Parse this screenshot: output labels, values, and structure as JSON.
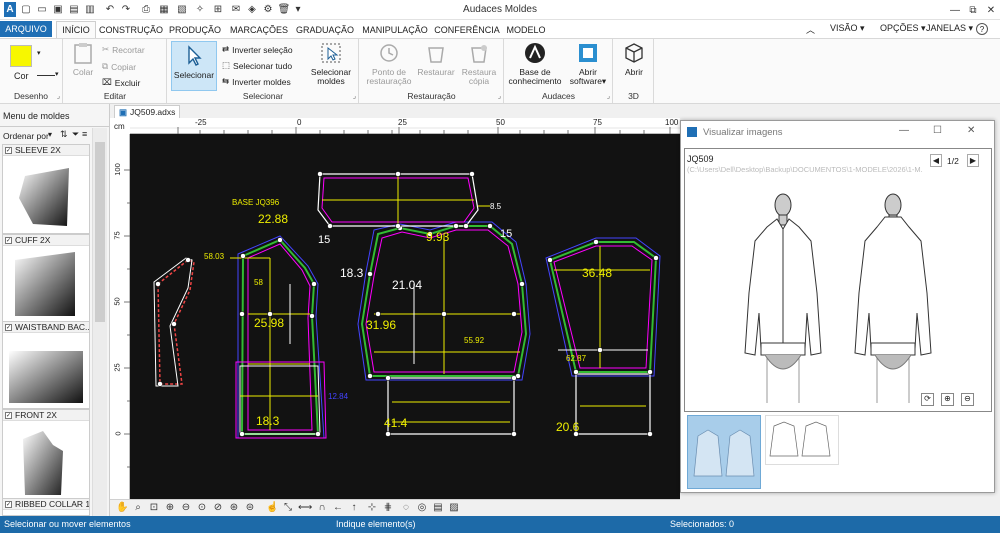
{
  "app": {
    "title": "Audaces Moldes"
  },
  "window_controls": {
    "min": "—",
    "max": "⧉",
    "close": "✕"
  },
  "tabs": [
    "ARQUIVO",
    "INÍCIO",
    "CONSTRUÇÃO",
    "PRODUÇÃO",
    "MARCAÇÕES",
    "GRADUAÇÃO",
    "MANIPULAÇÃO",
    "CONFERÊNCIA",
    "MODELO"
  ],
  "right_menus": [
    "VISÃO ▾",
    "OPÇÕES ▾",
    "JANELAS ▾",
    "?"
  ],
  "ribbon": {
    "desenho": {
      "label": "Desenho",
      "cor": "Cor",
      "color": "#f7f700"
    },
    "editar": {
      "label": "Editar",
      "colar": "Colar",
      "recortar": "Recortar",
      "copiar": "Copiar",
      "excluir": "Excluir"
    },
    "selecionar": {
      "label": "Selecionar",
      "selecionar": "Selecionar",
      "inverter_selecao": "Inverter seleção",
      "selecionar_tudo": "Selecionar tudo",
      "inverter_moldes": "Inverter moldes",
      "selecionar_moldes": "Selecionar moldes"
    },
    "restauracao": {
      "label": "Restauração",
      "ponto": "Ponto de restauração",
      "restaurar": "Restaurar",
      "restaura_copia": "Restaura cópia"
    },
    "audaces": {
      "label": "Audaces",
      "base": "Base de conhecimento",
      "abrir_software": "Abrir software▾"
    },
    "tresd": {
      "label": "3D",
      "abrir": "Abrir"
    }
  },
  "doc_tab": "JQ509.adxs",
  "left_panel": {
    "title": "Menu de moldes",
    "sort_label": "Ordenar por",
    "molds": [
      "SLEEVE 2X",
      "CUFF 2X",
      "WAISTBAND BAC...",
      "FRONT 2X",
      "RIBBED COLLAR 1X"
    ]
  },
  "ruler": {
    "unit": "cm",
    "h_ticks": [
      "-25",
      "0",
      "25",
      "50",
      "75",
      "100",
      "125"
    ],
    "v_ticks": [
      "100",
      "75",
      "50",
      "25",
      "0"
    ]
  },
  "drawing_labels": {
    "base": "BASE JQ396",
    "m1": "22.88",
    "m2": "15",
    "m3": "58.03",
    "m4": "18.3",
    "m5": "58",
    "m6": "25.98",
    "m7": "9.93",
    "m8": "15",
    "m9": "21.04",
    "m10": "31.96",
    "m11": "55.92",
    "m12": "8.5",
    "m13": "36.48",
    "m14": "62.87",
    "m15": "12.84",
    "m16": "18.3",
    "m17": "41.4",
    "m18": "20.6"
  },
  "image_window": {
    "title": "Visualizar imagens",
    "name": "JQ509",
    "path": "(C:\\Users\\Dell\\Desktop\\Backup\\DOCUMENTOS\\1-MODELE\\2026\\1-M...",
    "page": "1/2"
  },
  "status": {
    "left": "Selecionar ou mover elementos",
    "mid": "Indique elemento(s)",
    "right": "Selecionados: 0"
  }
}
